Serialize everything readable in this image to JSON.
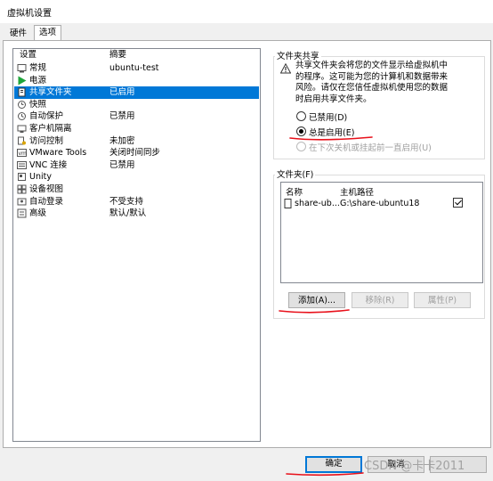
{
  "window": {
    "title": "虚拟机设置"
  },
  "tabs": [
    {
      "label": "硬件"
    },
    {
      "label": "选项"
    }
  ],
  "list": {
    "header_setting": "设置",
    "header_summary": "摘要",
    "items": [
      {
        "name": "常规",
        "summary": "ubuntu-test",
        "icon": "general-icon"
      },
      {
        "name": "电源",
        "summary": "",
        "icon": "power-icon"
      },
      {
        "name": "共享文件夹",
        "summary": "已启用",
        "icon": "shared-folder-icon"
      },
      {
        "name": "快照",
        "summary": "",
        "icon": "snapshot-icon"
      },
      {
        "name": "自动保护",
        "summary": "已禁用",
        "icon": "autoprotect-icon"
      },
      {
        "name": "客户机隔离",
        "summary": "",
        "icon": "isolation-icon"
      },
      {
        "name": "访问控制",
        "summary": "未加密",
        "icon": "access-control-icon"
      },
      {
        "name": "VMware Tools",
        "summary": "关闭时间同步",
        "icon": "vmware-tools-icon"
      },
      {
        "name": "VNC 连接",
        "summary": "已禁用",
        "icon": "vnc-icon"
      },
      {
        "name": "Unity",
        "summary": "",
        "icon": "unity-icon"
      },
      {
        "name": "设备视图",
        "summary": "",
        "icon": "device-view-icon"
      },
      {
        "name": "自动登录",
        "summary": "不受支持",
        "icon": "autologin-icon"
      },
      {
        "name": "高级",
        "summary": "默认/默认",
        "icon": "advanced-icon"
      }
    ],
    "selected_index": 2
  },
  "sharing": {
    "group_title": "文件夹共享",
    "description": "共享文件夹会将您的文件显示给虚拟机中的程序。这可能为您的计算机和数据带来风险。请仅在您信任虚拟机使用您的数据时启用共享文件夹。",
    "options": [
      {
        "label": "已禁用(D)",
        "selected": false,
        "enabled": true
      },
      {
        "label": "总是启用(E)",
        "selected": true,
        "enabled": true
      },
      {
        "label": "在下次关机或挂起前一直启用(U)",
        "selected": false,
        "enabled": false
      }
    ]
  },
  "folders": {
    "group_title": "文件夹(F)",
    "col_name": "名称",
    "col_path": "主机路径",
    "rows": [
      {
        "name": "share-ub...",
        "path": "G:\\share-ubuntu18",
        "checked": true
      }
    ],
    "add_label": "添加(A)...",
    "remove_label": "移除(R)",
    "properties_label": "属性(P)"
  },
  "footer": {
    "ok_label": "确定",
    "cancel_label": "取消"
  },
  "watermark": "CSDN @卡卡2011",
  "annotation_color": "#e8101a"
}
